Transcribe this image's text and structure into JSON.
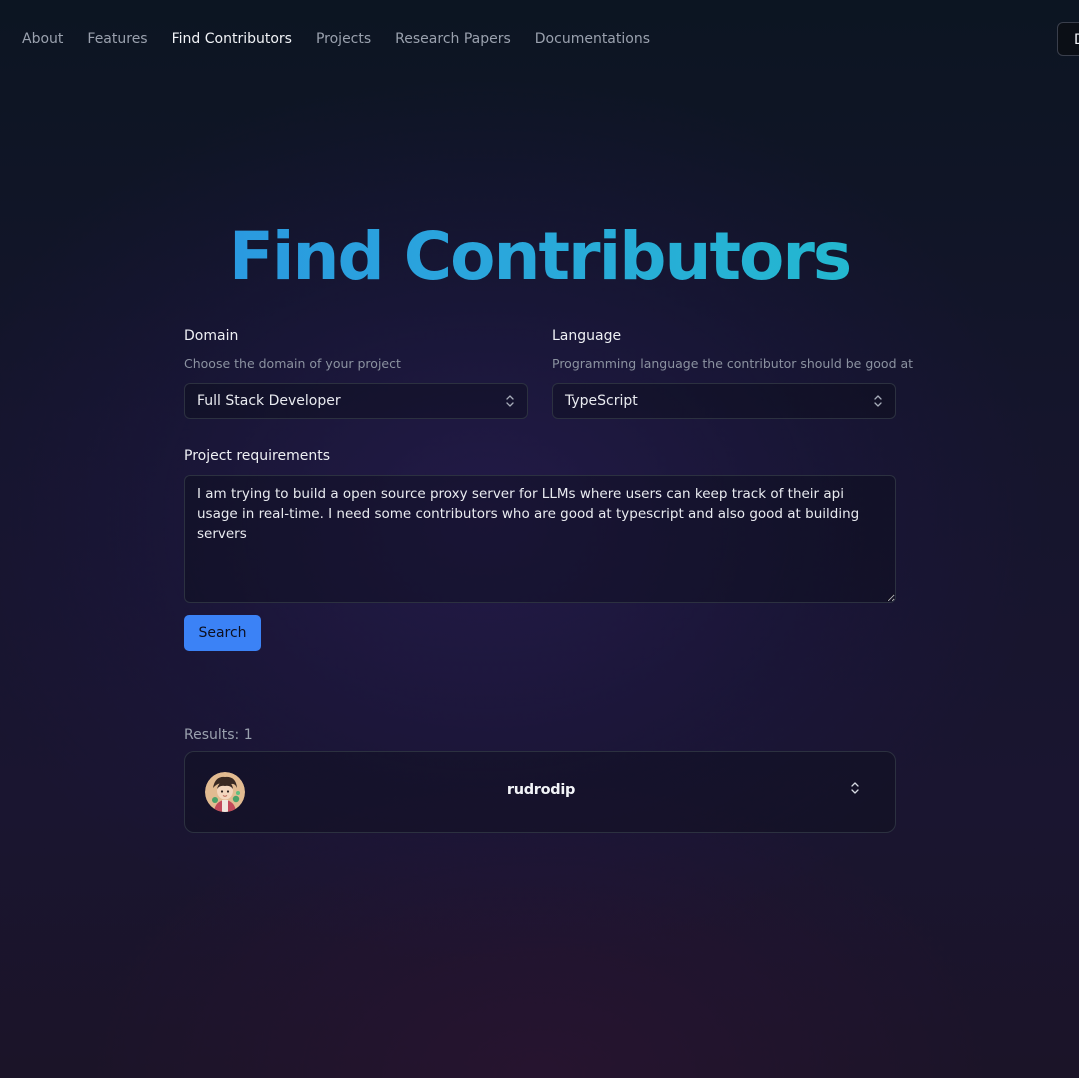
{
  "nav": {
    "links": [
      {
        "label": "About"
      },
      {
        "label": "Features"
      },
      {
        "label": "Find Contributors"
      },
      {
        "label": "Projects"
      },
      {
        "label": "Research Papers"
      },
      {
        "label": "Documentations"
      }
    ],
    "active": "Find Contributors",
    "cta_label": "D"
  },
  "page": {
    "title": "Find Contributors"
  },
  "form": {
    "domain": {
      "label": "Domain",
      "description": "Choose the domain of your project",
      "value": "Full Stack Developer"
    },
    "language": {
      "label": "Language",
      "description": "Programming language the contributor should be good at",
      "value": "TypeScript"
    },
    "requirements": {
      "label": "Project requirements",
      "value": "I am trying to build a open source proxy server for LLMs where users can keep track of their api usage in real-time. I need some contributors who are good at typescript and also good at building servers"
    },
    "search_label": "Search"
  },
  "results": {
    "count_label": "Results: 1",
    "items": [
      {
        "username": "rudrodip",
        "icon": "chevron-up-down-icon"
      }
    ]
  },
  "colors": {
    "accent": "#3b82f6",
    "title_gradient_start": "#2a8fe3",
    "title_gradient_end": "#1fc3c8"
  }
}
